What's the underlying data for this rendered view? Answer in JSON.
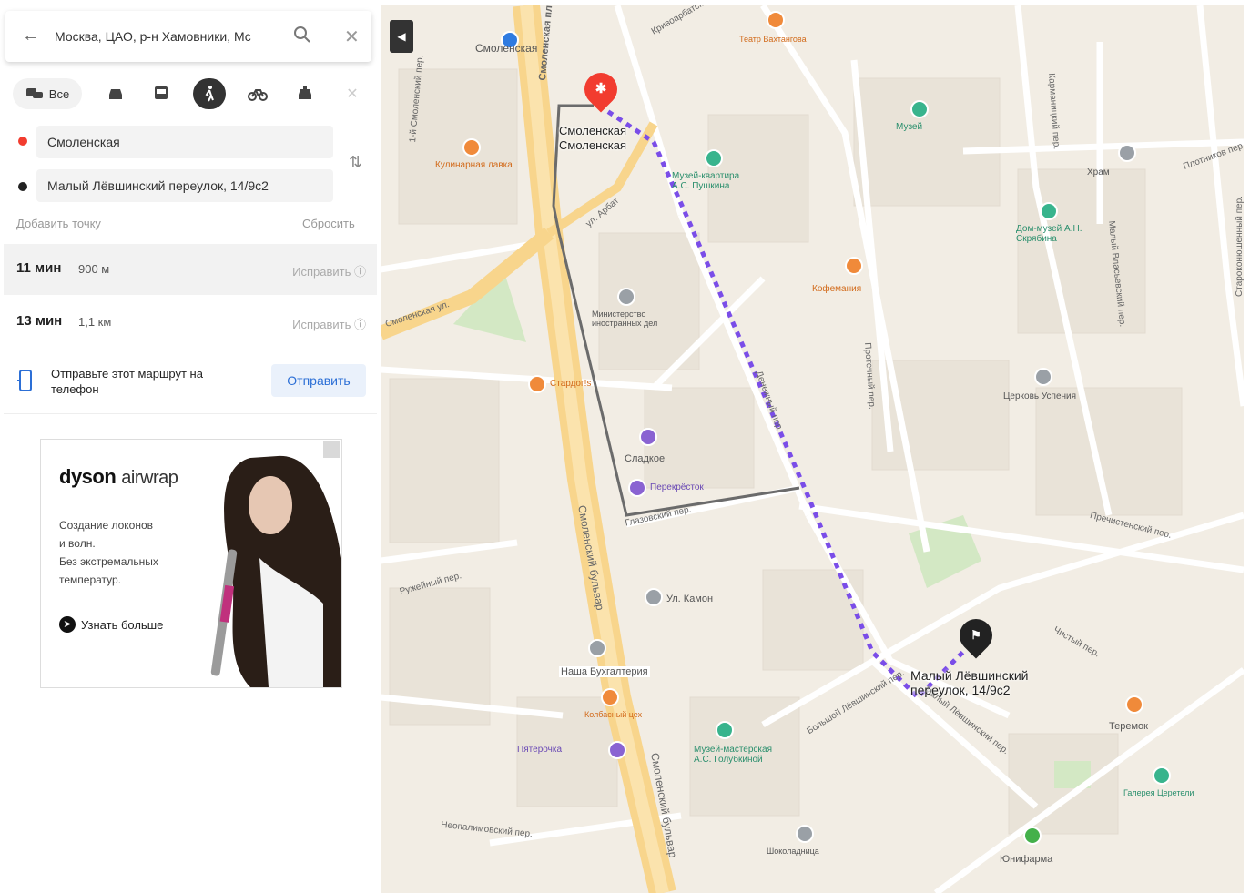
{
  "search": {
    "query": "Москва, ЦАО, р-н Хамовники, Мс"
  },
  "modes": {
    "all_label": "Все"
  },
  "route_points": {
    "from": "Смоленская",
    "to": "Малый Лёвшинский переулок, 14/9с2",
    "add_point": "Добавить точку",
    "reset": "Сбросить"
  },
  "routes": [
    {
      "time": "11 мин",
      "distance": "900 м",
      "fix": "Исправить"
    },
    {
      "time": "13 мин",
      "distance": "1,1 км",
      "fix": "Исправить"
    }
  ],
  "send": {
    "text": "Отправьте этот маршрут на телефон",
    "button": "Отправить"
  },
  "ad": {
    "brand": "dyson",
    "product": "airwrap",
    "description": "Создание локонов\nи волн.\nБез экстремальных\nтемператур.",
    "more": "Узнать больше"
  },
  "map": {
    "collapse_icon": "chevron-left-icon",
    "start_label": "Смоленская\nСмоленская",
    "end_label": "Малый Лёвшинский\nпереулок, 14/9с2",
    "streets": [
      "Смоленская пл.",
      "Смоленская ул.",
      "ул. Арбат",
      "Смоленский бульвар",
      "Смоленский бульвар",
      "Глазовский пер.",
      "Пречистенский пер.",
      "Протечный пер.",
      "Малый Власьевский пер.",
      "Денежный пер.",
      "Большой Лёвшинский пер.",
      "Малый Лёвшинский пер.",
      "Чистый пер.",
      "Кривоарбатский пер.",
      "Староконюшенный пер.",
      "Плотников пер.",
      "Карманицкий пер.",
      "1-й Смоленский пер.",
      "Ружейный пер.",
      "Неопалимовский пер."
    ],
    "pois": [
      "Смоленская",
      "Кулинарная лавка",
      "Музей-квартира А.С. Пушкина",
      "Музей",
      "Кофемания",
      "Дом-музей А.Н. Скрябина",
      "Храм",
      "Министерство иностранных дел",
      "Стардог!s",
      "Сладкое",
      "Перекрёсток",
      "Церковь Успения",
      "Ул. Камон",
      "Наша Бухгалтерия",
      "Колбасный цех",
      "Музей-мастерская А.С. Голубкиной",
      "Пятёрочка",
      "Теремок",
      "Юнифарма",
      "Галерея Церетели",
      "Театр Вахтангова",
      "Шоколадница"
    ]
  }
}
